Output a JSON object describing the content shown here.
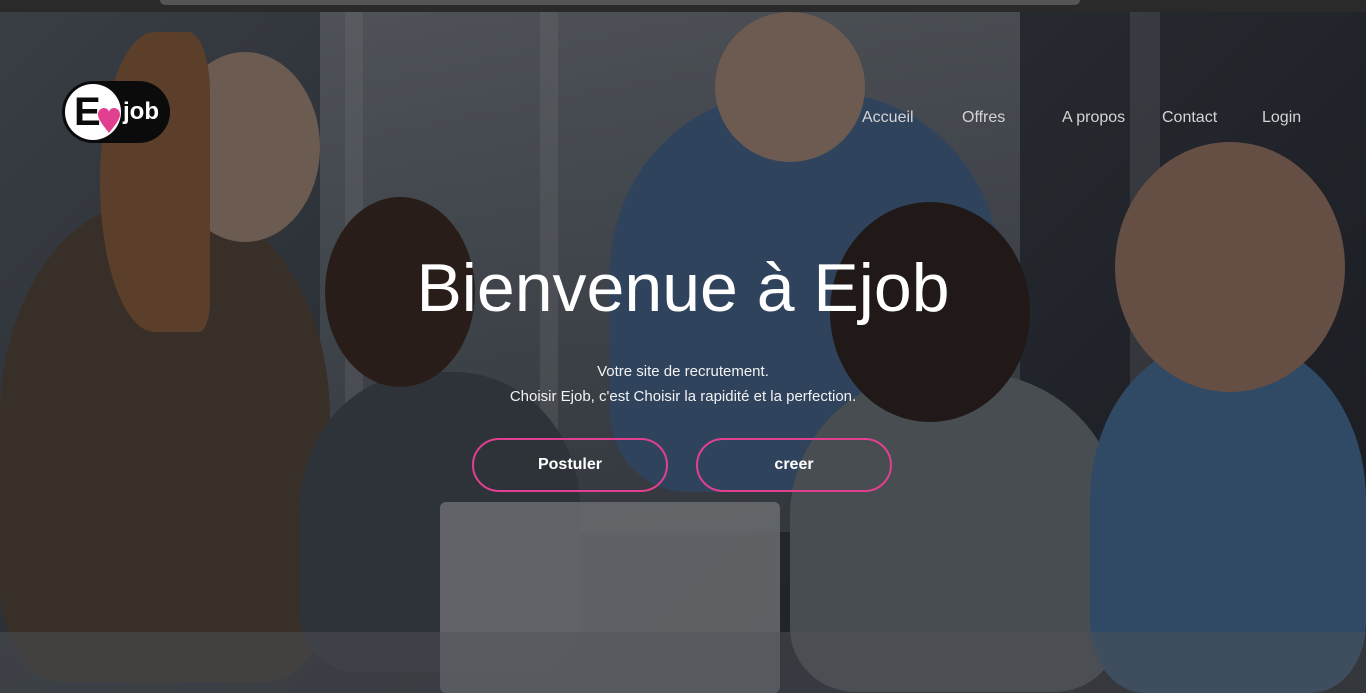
{
  "brand": {
    "logo_letter": "E",
    "logo_text": "job",
    "accent_color": "#e0408f"
  },
  "nav": {
    "items": [
      {
        "label": "Accueil"
      },
      {
        "label": "Offres"
      },
      {
        "label": "A propos"
      },
      {
        "label": "Contact"
      },
      {
        "label": "Login"
      }
    ]
  },
  "hero": {
    "title": "Bienvenue à Ejob",
    "subtitle_line1": "Votre site de recrutement.",
    "subtitle_line2": "Choisir Ejob, c'est Choisir la rapidité et la perfection.",
    "primary_button": "Postuler",
    "secondary_button": "creer",
    "background_image": "office-team-meeting-photo"
  }
}
